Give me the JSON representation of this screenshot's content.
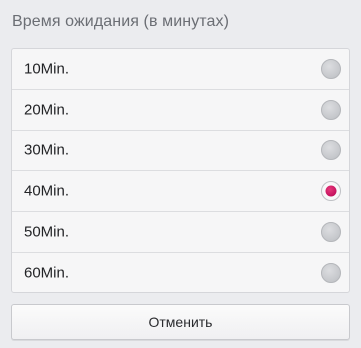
{
  "dialog": {
    "title": "Время ожидания (в минутах)",
    "options": [
      {
        "label": "10Min.",
        "selected": false
      },
      {
        "label": "20Min.",
        "selected": false
      },
      {
        "label": "30Min.",
        "selected": false
      },
      {
        "label": "40Min.",
        "selected": true
      },
      {
        "label": "50Min.",
        "selected": false
      },
      {
        "label": "60Min.",
        "selected": false
      }
    ],
    "cancel_label": "Отменить"
  },
  "colors": {
    "accent": "#c71461",
    "background": "#ebecef"
  }
}
